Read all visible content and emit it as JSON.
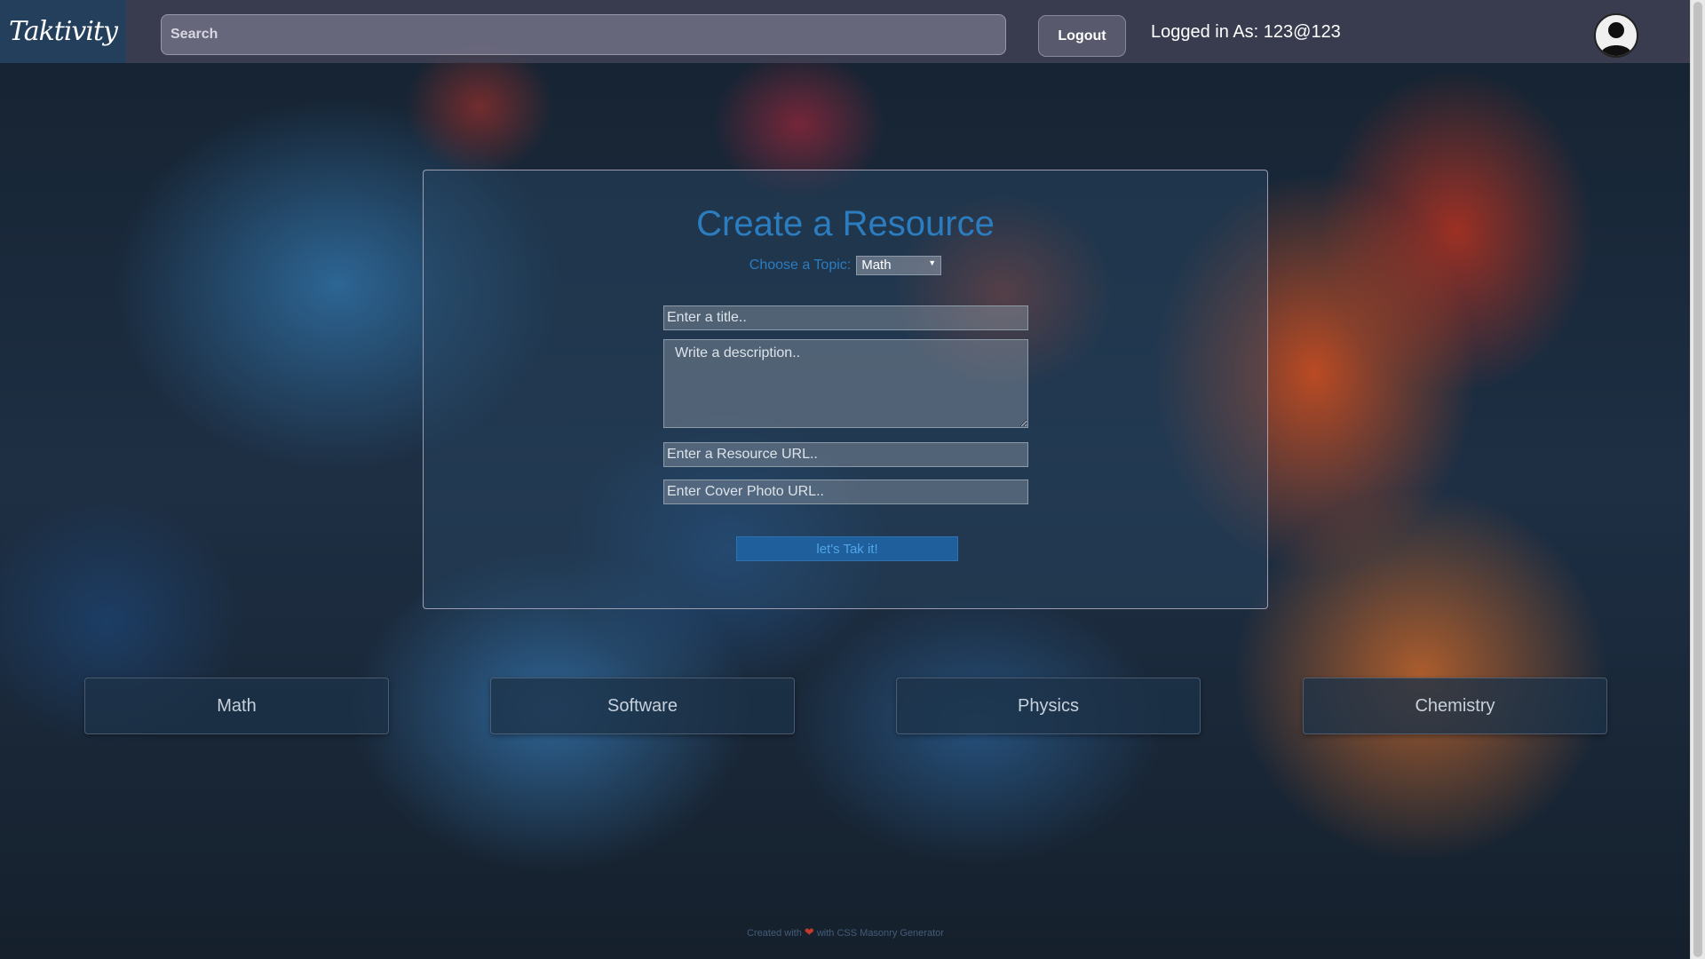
{
  "header": {
    "logo_text": "Taktivity",
    "search": {
      "placeholder": "Search",
      "value": ""
    },
    "logout_label": "Logout",
    "logged_in_text": "Logged in As: 123@123"
  },
  "form": {
    "title": "Create a Resource",
    "topic_label": "Choose a Topic:",
    "topic_selected": "Math",
    "title_placeholder": "Enter a title..",
    "description_placeholder": "Write a description..",
    "resource_url_placeholder": "Enter a Resource URL..",
    "cover_photo_placeholder": "Enter Cover Photo URL..",
    "submit_label": "let's Tak it!"
  },
  "topics": [
    {
      "label": "Math"
    },
    {
      "label": "Software"
    },
    {
      "label": "Physics"
    },
    {
      "label": "Chemistry"
    }
  ],
  "footer": {
    "prefix": "Created with",
    "suffix": "with CSS Masonry Generator"
  },
  "colors": {
    "accent": "#2c7cc0",
    "submit_bg": "#1f5f9c",
    "topbar": "#46465a",
    "logo_bg": "#243f5c"
  }
}
